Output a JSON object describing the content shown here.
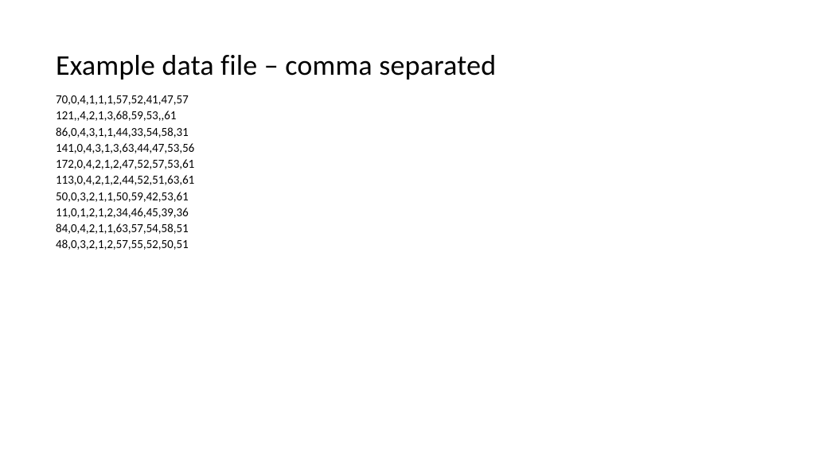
{
  "title": "Example data file – comma separated",
  "lines": [
    "70,0,4,1,1,1,57,52,41,47,57",
    "121,,4,2,1,3,68,59,53,,61",
    "86,0,4,3,1,1,44,33,54,58,31",
    "141,0,4,3,1,3,63,44,47,53,56",
    "172,0,4,2,1,2,47,52,57,53,61",
    "113,0,4,2,1,2,44,52,51,63,61",
    "50,0,3,2,1,1,50,59,42,53,61",
    "11,0,1,2,1,2,34,46,45,39,36",
    "84,0,4,2,1,1,63,57,54,58,51",
    "48,0,3,2,1,2,57,55,52,50,51"
  ]
}
